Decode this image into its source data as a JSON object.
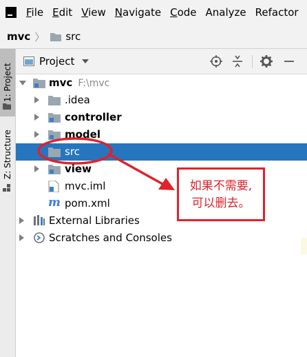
{
  "menu": {
    "items": [
      {
        "mnemonic": "F",
        "rest": "ile"
      },
      {
        "mnemonic": "E",
        "rest": "dit"
      },
      {
        "mnemonic": "V",
        "rest": "iew"
      },
      {
        "mnemonic": "N",
        "rest": "avigate"
      },
      {
        "mnemonic": "C",
        "rest": "ode"
      },
      {
        "mnemonic": "",
        "rest": "Analyze"
      },
      {
        "mnemonic": "",
        "rest": "Refactor"
      }
    ]
  },
  "breadcrumb": {
    "root": "mvc",
    "separator": "〉",
    "child": "src"
  },
  "side_strip": {
    "project_tab": "1: Project",
    "structure_tab": "Z: Structure"
  },
  "panel": {
    "title": "Project"
  },
  "tree": {
    "root": {
      "label": "mvc",
      "path": "F:\\mvc"
    },
    "idea": ".idea",
    "controller": "controller",
    "model": "model",
    "src": "src",
    "view": "view",
    "iml": "mvc.iml",
    "pom": "pom.xml",
    "ext_libs": "External Libraries",
    "scratches": "Scratches and Consoles"
  },
  "annotation": {
    "line1": "如果不需要,",
    "line2": "可以删去。"
  },
  "colors": {
    "selection": "#2675bf",
    "annotation": "#e0222a",
    "folder": "#9aa7b0"
  }
}
